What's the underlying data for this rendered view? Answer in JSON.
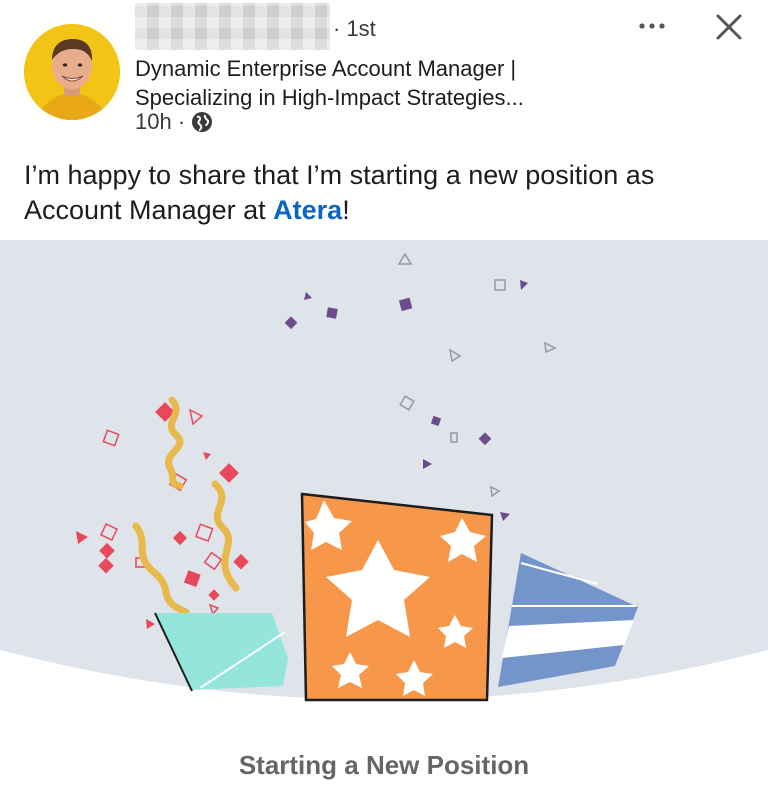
{
  "post": {
    "author": {
      "degree": "· 1st",
      "headline_line1": "Dynamic Enterprise Account Manager |",
      "headline_line2": "Specializing in High-Impact Strategies...",
      "time": "10h ·",
      "visibility_icon": "globe-icon"
    },
    "actions": {
      "more_icon": "more-horizontal-icon",
      "close_icon": "close-icon"
    },
    "text_part1": "I’m happy to share that I’m starting a new position as Account Manager at ",
    "mention": "Atera",
    "text_part2": "!",
    "card": {
      "title": "Starting a New Position"
    }
  },
  "colors": {
    "link": "#0a66c2",
    "card_background": "#dfe3ea",
    "teal_box": "#94e6dc",
    "orange_box": "#f7974a",
    "blue_box": "#7395c9",
    "confetti_red": "#e8495a",
    "confetti_gold": "#e7b94a",
    "confetti_purple": "#6d4c8c"
  }
}
